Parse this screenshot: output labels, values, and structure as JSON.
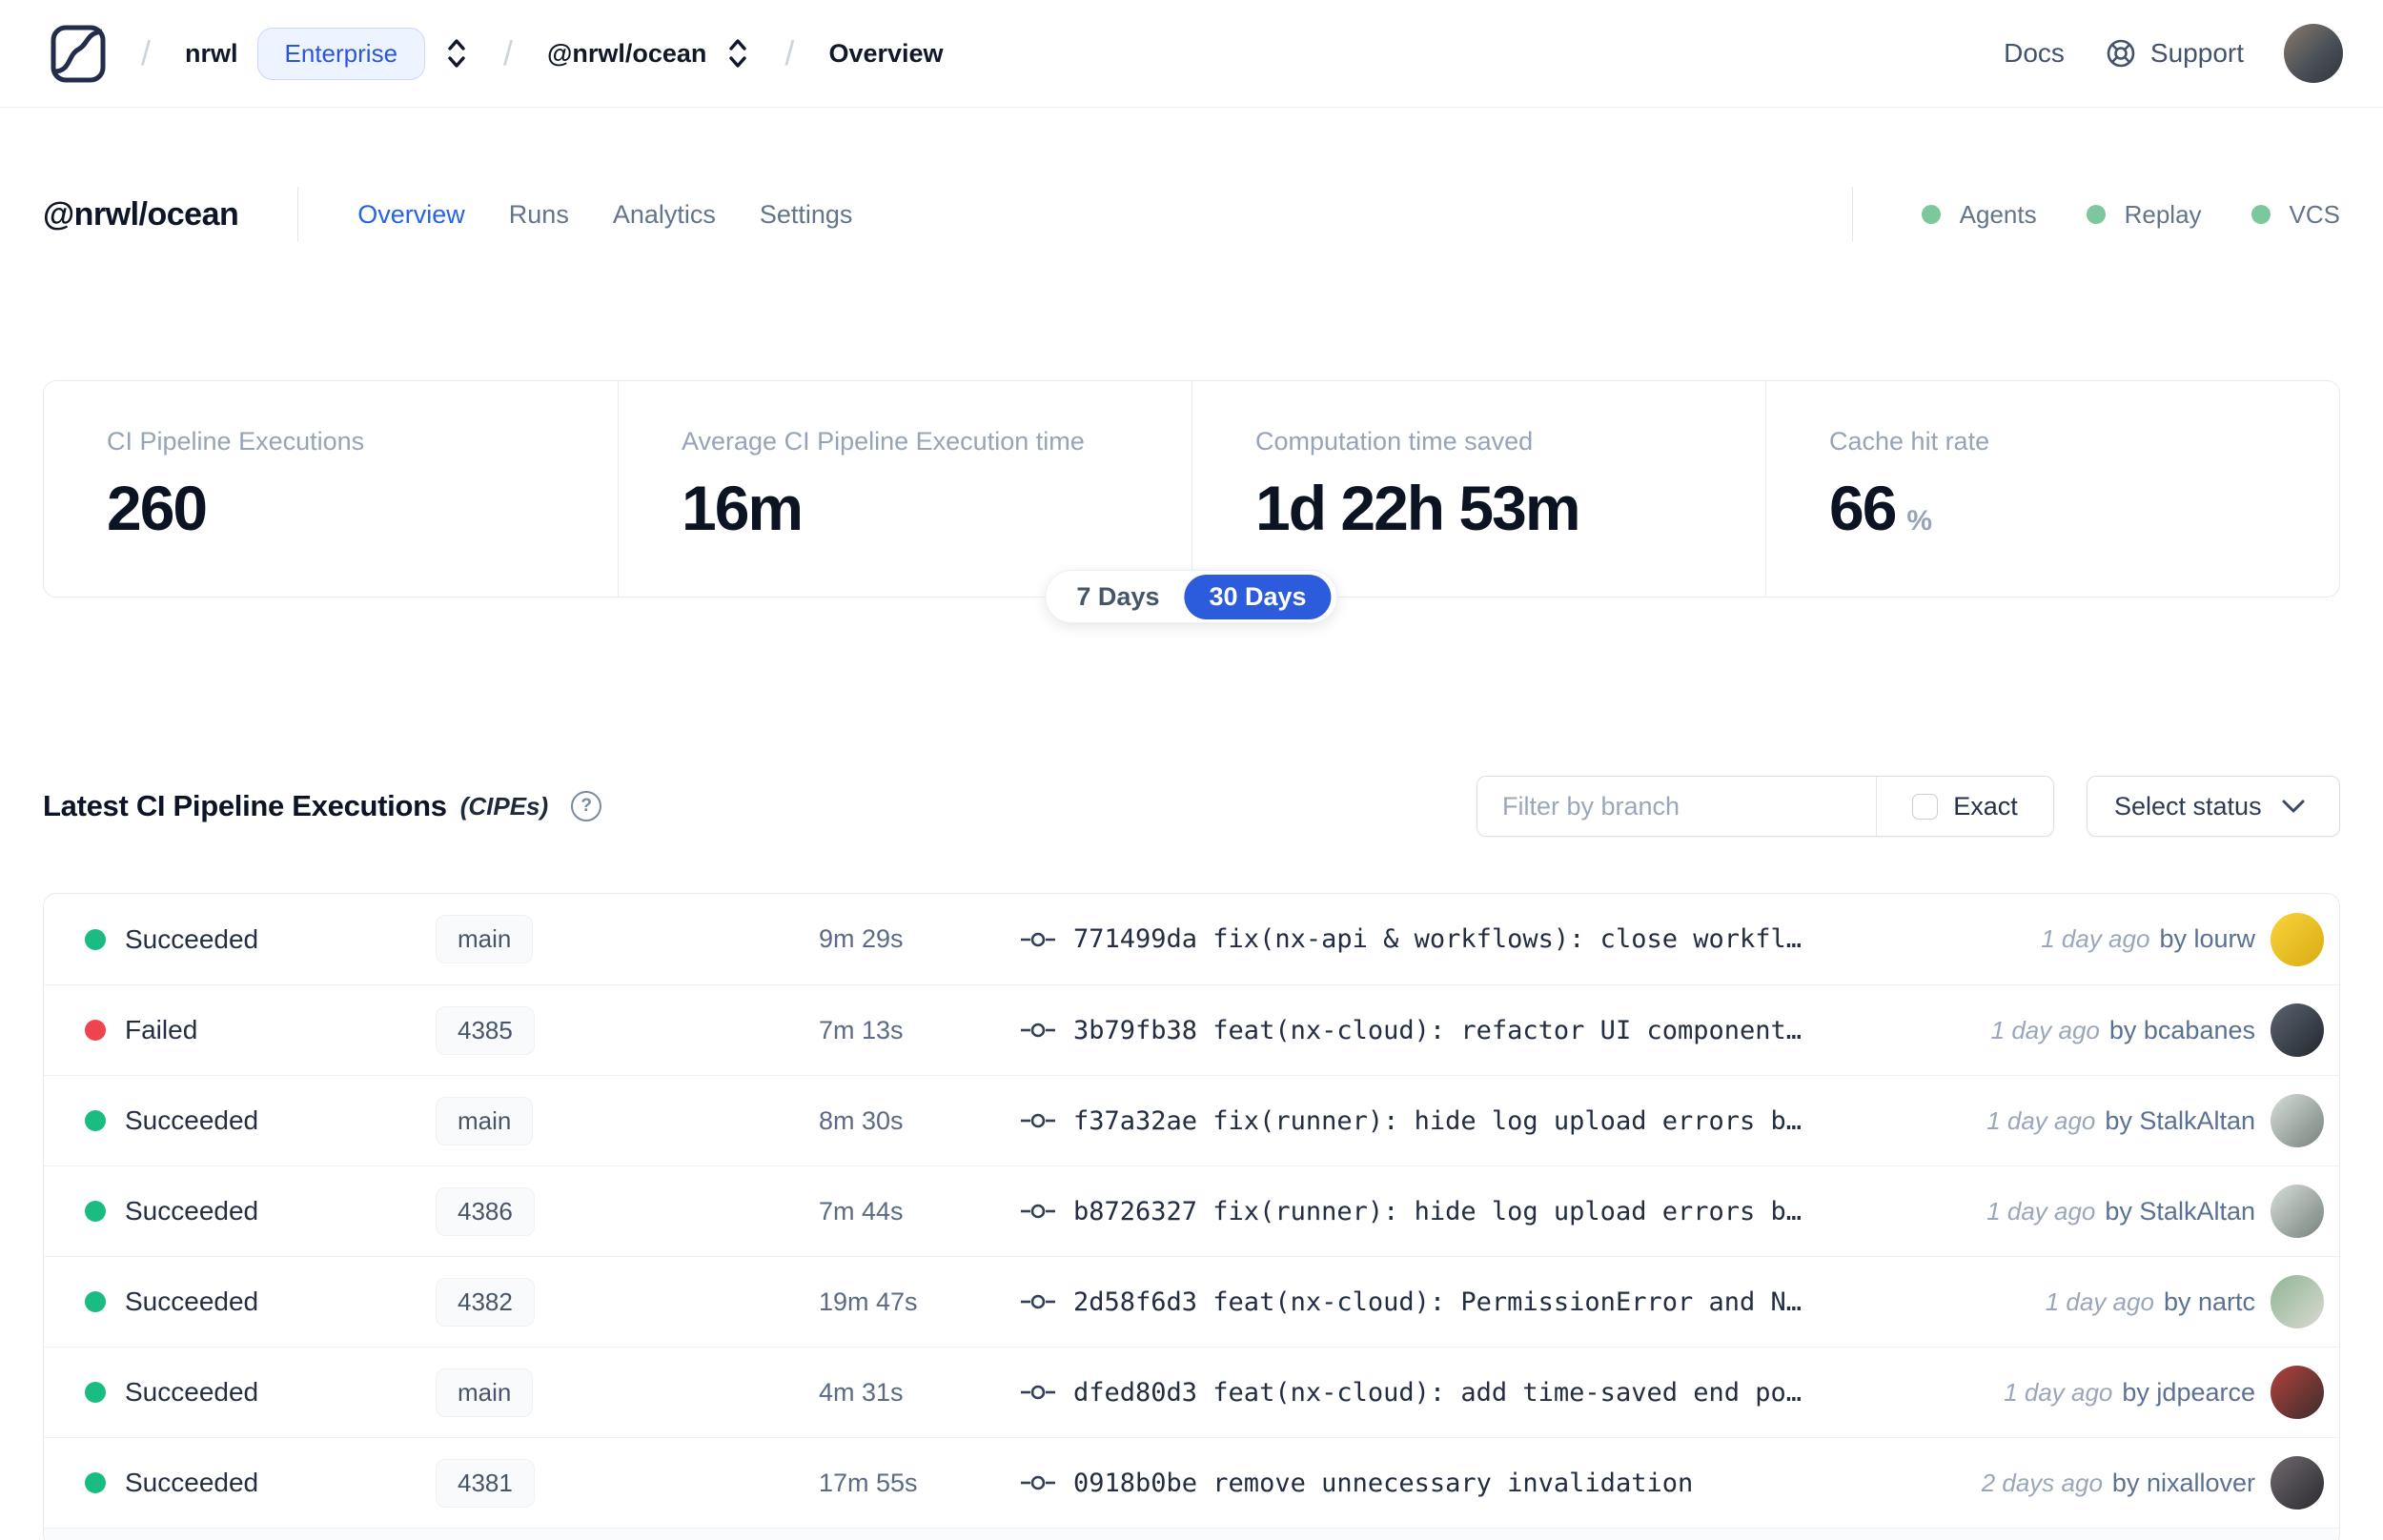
{
  "header": {
    "breadcrumb": {
      "separator": "/",
      "org": "nrwl",
      "org_badge": "Enterprise",
      "workspace": "@nrwl/ocean",
      "page": "Overview"
    },
    "docs_label": "Docs",
    "support_label": "Support"
  },
  "workspace": {
    "title": "@nrwl/ocean",
    "tabs": [
      {
        "label": "Overview",
        "active": true
      },
      {
        "label": "Runs",
        "active": false
      },
      {
        "label": "Analytics",
        "active": false
      },
      {
        "label": "Settings",
        "active": false
      }
    ],
    "features": [
      {
        "label": "Agents"
      },
      {
        "label": "Replay"
      },
      {
        "label": "VCS"
      }
    ],
    "feature_dot_color": "#7cc79c"
  },
  "stats": {
    "cards": [
      {
        "label": "CI Pipeline Executions",
        "value": "260",
        "suffix": ""
      },
      {
        "label": "Average CI Pipeline Execution time",
        "value": "16m",
        "suffix": ""
      },
      {
        "label": "Computation time saved",
        "value": "1d 22h 53m",
        "suffix": ""
      },
      {
        "label": "Cache hit rate",
        "value": "66",
        "suffix": "%"
      }
    ],
    "range_toggle": {
      "options": [
        "7 Days",
        "30 Days"
      ],
      "selected": "30 Days",
      "selected_color": "#2c5cdb"
    }
  },
  "cipe_section": {
    "title": "Latest CI Pipeline Executions",
    "title_suffix": "(CIPEs)",
    "help_glyph": "?",
    "filter_placeholder": "Filter by branch",
    "exact_label": "Exact",
    "exact_checked": false,
    "status_select_label": "Select status"
  },
  "table": {
    "rows": [
      {
        "status": "Succeeded",
        "status_color": "#19bd81",
        "branch": "main",
        "duration": "9m 29s",
        "commit": "771499da fix(nx-api & workflows): close workfl…",
        "time": "1 day ago",
        "author": "by lourw",
        "avatar_colors": [
          "#f9d43b",
          "#d9ab13"
        ]
      },
      {
        "status": "Failed",
        "status_color": "#ef4450",
        "branch": "4385",
        "duration": "7m 13s",
        "commit": "3b79fb38 feat(nx-cloud): refactor UI component…",
        "time": "1 day ago",
        "author": "by bcabanes",
        "avatar_colors": [
          "#5a6470",
          "#23282f"
        ]
      },
      {
        "status": "Succeeded",
        "status_color": "#19bd81",
        "branch": "main",
        "duration": "8m 30s",
        "commit": "f37a32ae fix(runner): hide log upload errors b…",
        "time": "1 day ago",
        "author": "by StalkAltan",
        "avatar_colors": [
          "#d7ded9",
          "#76827d"
        ]
      },
      {
        "status": "Succeeded",
        "status_color": "#19bd81",
        "branch": "4386",
        "duration": "7m 44s",
        "commit": "b8726327 fix(runner): hide log upload errors b…",
        "time": "1 day ago",
        "author": "by StalkAltan",
        "avatar_colors": [
          "#d7ded9",
          "#76827d"
        ]
      },
      {
        "status": "Succeeded",
        "status_color": "#19bd81",
        "branch": "4382",
        "duration": "19m 47s",
        "commit": "2d58f6d3 feat(nx-cloud): PermissionError and N…",
        "time": "1 day ago",
        "author": "by nartc",
        "avatar_colors": [
          "#8fb694",
          "#d9d9d2"
        ]
      },
      {
        "status": "Succeeded",
        "status_color": "#19bd81",
        "branch": "main",
        "duration": "4m 31s",
        "commit": "dfed80d3 feat(nx-cloud): add time-saved end po…",
        "time": "1 day ago",
        "author": "by jdpearce",
        "avatar_colors": [
          "#b4413c",
          "#3a2e2c"
        ]
      },
      {
        "status": "Succeeded",
        "status_color": "#19bd81",
        "branch": "4381",
        "duration": "17m 55s",
        "commit": "0918b0be remove unnecessary invalidation",
        "time": "2 days ago",
        "author": "by nixallover",
        "avatar_colors": [
          "#6f6a6e",
          "#2c2a30"
        ]
      }
    ]
  }
}
